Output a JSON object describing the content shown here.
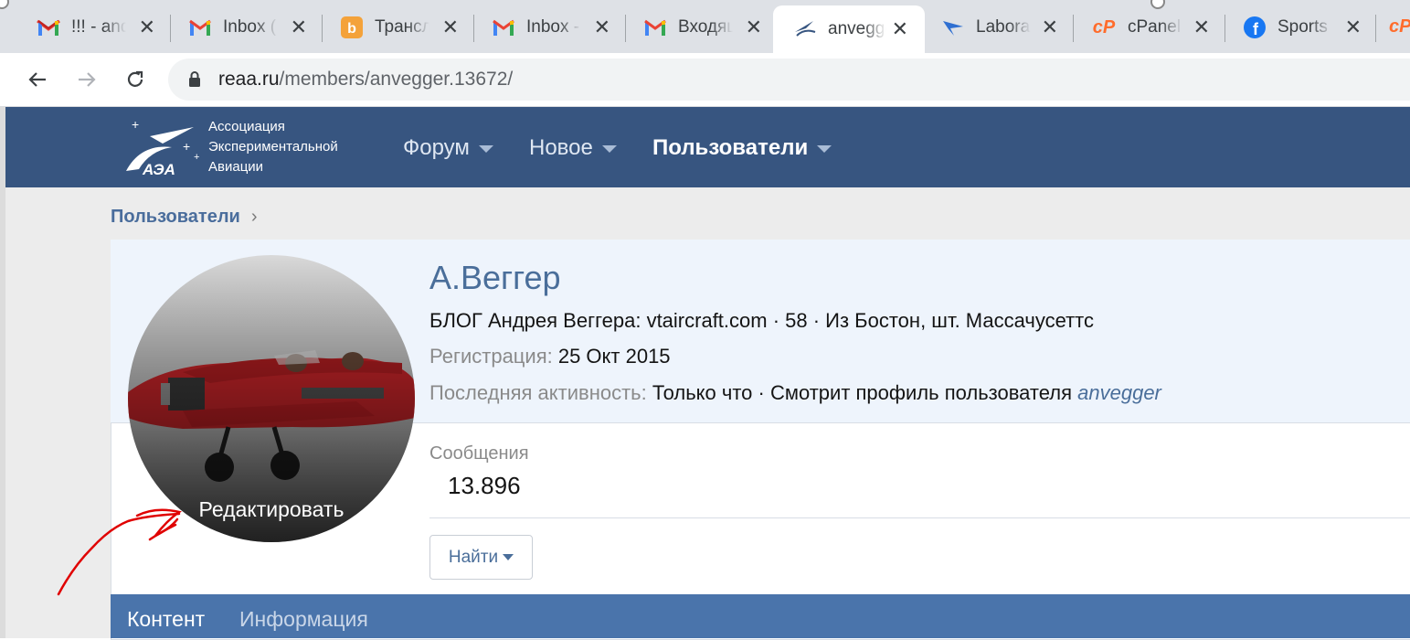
{
  "browser": {
    "tabs": [
      {
        "title": "!!! - andrew",
        "favicon": "gmail-icon"
      },
      {
        "title": "Inbox (",
        "favicon": "gmail-icon"
      },
      {
        "title": "Трансл",
        "favicon": "translate-icon"
      },
      {
        "title": "Inbox -",
        "favicon": "gmail-icon"
      },
      {
        "title": "Входящ",
        "favicon": "gmail-icon"
      },
      {
        "title": "anvegger",
        "favicon": "reaa-icon",
        "active": true
      },
      {
        "title": "Labora",
        "favicon": "bird-icon"
      },
      {
        "title": "cPanel",
        "favicon": "cpanel-icon"
      },
      {
        "title": "Sports",
        "favicon": "facebook-icon"
      }
    ],
    "url_host": "reaa.ru",
    "url_path": "/members/anvegger.13672/"
  },
  "site": {
    "logo_lines": [
      "Ассоциация",
      "Экспериментальной",
      "Авиации"
    ],
    "logo_mark": "АЭА",
    "nav": [
      {
        "label": "Форум"
      },
      {
        "label": "Новое"
      },
      {
        "label": "Пользователи",
        "selected": true
      }
    ]
  },
  "breadcrumb": {
    "label": "Пользователи",
    "chevron": "›"
  },
  "profile": {
    "name": "А.Веггер",
    "blurb": "БЛОГ Андрея Веггера: vtaircraft.com · 58 · Из Бостон, шт. Массачусеттс",
    "reg_label": "Регистрация:",
    "reg_value": "25 Окт 2015",
    "activity_label": "Последняя активность:",
    "activity_value": "Только что · Смотрит профиль пользователя",
    "activity_link": "anvegger",
    "messages_label": "Сообщения",
    "messages_value": "13.896",
    "find_button": "Найти",
    "avatar_edit": "Редактировать"
  },
  "profile_tabs": [
    {
      "label": "Контент"
    },
    {
      "label": "Информация"
    }
  ],
  "colors": {
    "header": "#375580",
    "accent_link": "#4a6e9a",
    "tabs_bar": "#4a74ab",
    "annotation": "#e00000"
  }
}
